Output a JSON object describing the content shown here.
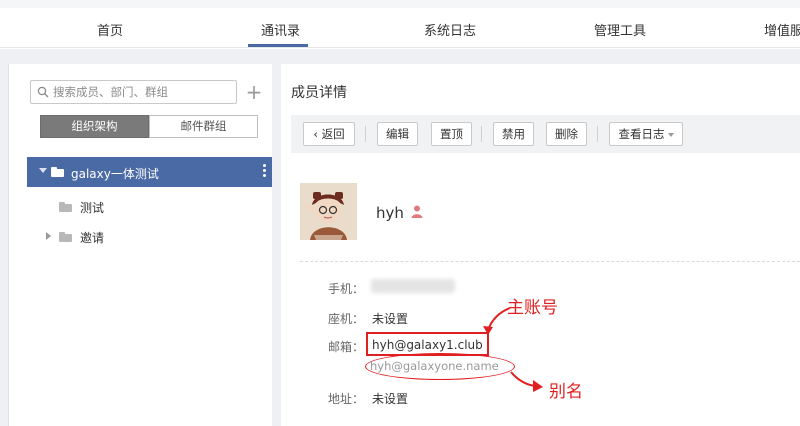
{
  "nav": {
    "tabs": [
      {
        "label": "首页"
      },
      {
        "label": "通讯录"
      },
      {
        "label": "系统日志"
      },
      {
        "label": "管理工具"
      },
      {
        "label": "增值服"
      }
    ],
    "active_tab": "通讯录",
    "accent_color": "#4a6aa5"
  },
  "sidebar": {
    "search": {
      "placeholder": "搜索成员、部门、群组",
      "value": ""
    },
    "add_icon": "plus-icon",
    "segments": [
      {
        "label": "组织架构",
        "selected": true
      },
      {
        "label": "邮件群组",
        "selected": false
      }
    ],
    "tree": {
      "root": {
        "label": "galaxy一体测试",
        "expanded": true,
        "selected": true
      },
      "children": [
        {
          "label": "测试",
          "expandable": false
        },
        {
          "label": "邀请",
          "expandable": true
        }
      ]
    }
  },
  "main": {
    "title": "成员详情",
    "toolbar": {
      "back": "返回",
      "edit": "编辑",
      "pin": "置顶",
      "disable": "禁用",
      "delete": "删除",
      "view_log": "查看日志"
    },
    "member": {
      "name": "hyh",
      "fields": {
        "mobile_label": "手机：",
        "landline_label": "座机：",
        "landline_value": "未设置",
        "email_label": "邮箱：",
        "email_value": "hyh@galaxy1.club",
        "email_alias": "hyh@galaxyone.name",
        "address_label": "地址：",
        "address_value": "未设置"
      }
    },
    "annotations": {
      "primary_account": "主账号",
      "alias": "别名",
      "color": "#e02020"
    }
  }
}
